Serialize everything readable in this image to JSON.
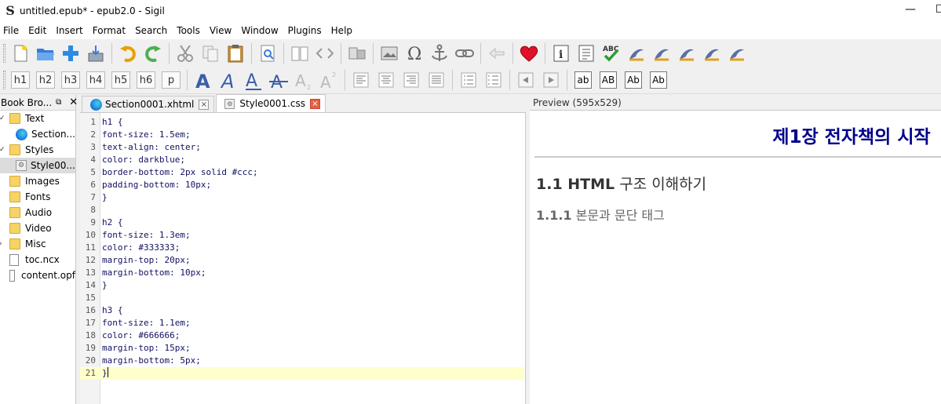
{
  "window": {
    "title": "untitled.epub* - epub2.0 - Sigil",
    "minimize": "—",
    "maximize": "☐"
  },
  "menu": [
    "File",
    "Edit",
    "Insert",
    "Format",
    "Search",
    "Tools",
    "View",
    "Window",
    "Plugins",
    "Help"
  ],
  "toolbar": {
    "headings": [
      "h1",
      "h2",
      "h3",
      "h4",
      "h5",
      "h6",
      "p"
    ],
    "case_buttons": [
      "ab",
      "AB",
      "Ab",
      "Ab"
    ],
    "heart_color": "#e0102a"
  },
  "book_browser": {
    "title": "Book Bro...",
    "float": "⧉",
    "close": "✕",
    "items": [
      {
        "label": "Text",
        "type": "folder",
        "toggle": "✓"
      },
      {
        "label": "Section...",
        "type": "xhtml"
      },
      {
        "label": "Styles",
        "type": "folder",
        "toggle": "✓"
      },
      {
        "label": "Style00...",
        "type": "css"
      },
      {
        "label": "Images",
        "type": "folder"
      },
      {
        "label": "Fonts",
        "type": "folder"
      },
      {
        "label": "Audio",
        "type": "folder"
      },
      {
        "label": "Video",
        "type": "folder"
      },
      {
        "label": "Misc",
        "type": "folder",
        "toggle": "›"
      },
      {
        "label": "toc.ncx",
        "type": "file"
      },
      {
        "label": "content.opf",
        "type": "file"
      }
    ]
  },
  "tabs": [
    {
      "label": "Section0001.xhtml",
      "close": "×"
    },
    {
      "label": "Style0001.css",
      "close": "×"
    }
  ],
  "editor": {
    "lines": [
      "h1 {",
      "font-size: 1.5em;",
      "text-align: center;",
      "color: darkblue;",
      "border-bottom: 2px solid #ccc;",
      "padding-bottom: 10px;",
      "}",
      "",
      "h2 {",
      "font-size: 1.3em;",
      "color: #333333;",
      "margin-top: 20px;",
      "margin-bottom: 10px;",
      "}",
      "",
      "h3 {",
      "font-size: 1.1em;",
      "color: #666666;",
      "margin-top: 15px;",
      "margin-bottom: 5px;",
      "}"
    ],
    "current_line": 21
  },
  "preview": {
    "header": "Preview (595x529)",
    "h1": "제1장 전자책의 시작",
    "h2_num": "1.1 HTML",
    "h2_text": " 구조 이해하기",
    "h3_num": "1.1.1",
    "h3_text": " 본문과 문단 태그"
  }
}
